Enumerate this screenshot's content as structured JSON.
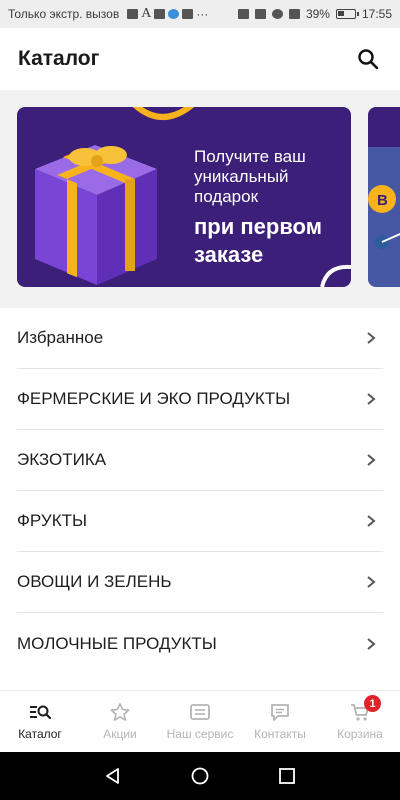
{
  "status_bar": {
    "carrier_text": "Только экстр. вызов",
    "battery": "39%",
    "battery_level": 0.39,
    "time": "17:55"
  },
  "header": {
    "title": "Каталог",
    "search_icon": "search-icon"
  },
  "banner": {
    "line1": "Получите ваш",
    "line2": "уникальный",
    "line3": "подарок",
    "bold1": "при первом",
    "bold2": "заказе",
    "colors": {
      "background": "#3c1f78",
      "gift_box": "#7a44d6",
      "ribbon": "#f7b21c"
    }
  },
  "categories": [
    {
      "label": "Избранное"
    },
    {
      "label": "ФЕРМЕРСКИЕ И ЭКО ПРОДУКТЫ"
    },
    {
      "label": "ЭКЗОТИКА"
    },
    {
      "label": "ФРУКТЫ"
    },
    {
      "label": "ОВОЩИ И ЗЕЛЕНЬ"
    },
    {
      "label": "МОЛОЧНЫЕ ПРОДУКТЫ"
    }
  ],
  "bottom_nav": {
    "tabs": [
      {
        "label": "Каталог",
        "icon": "catalog-icon",
        "active": true
      },
      {
        "label": "Акции",
        "icon": "star-icon",
        "active": false
      },
      {
        "label": "Наш сервис",
        "icon": "service-icon",
        "active": false
      },
      {
        "label": "Контакты",
        "icon": "chat-icon",
        "active": false
      },
      {
        "label": "Корзина",
        "icon": "cart-icon",
        "active": false
      }
    ],
    "cart_badge": "1"
  },
  "colors": {
    "accent_active": "#1e1e1e",
    "inactive": "#b4b4b4",
    "badge": "#e0242a"
  }
}
